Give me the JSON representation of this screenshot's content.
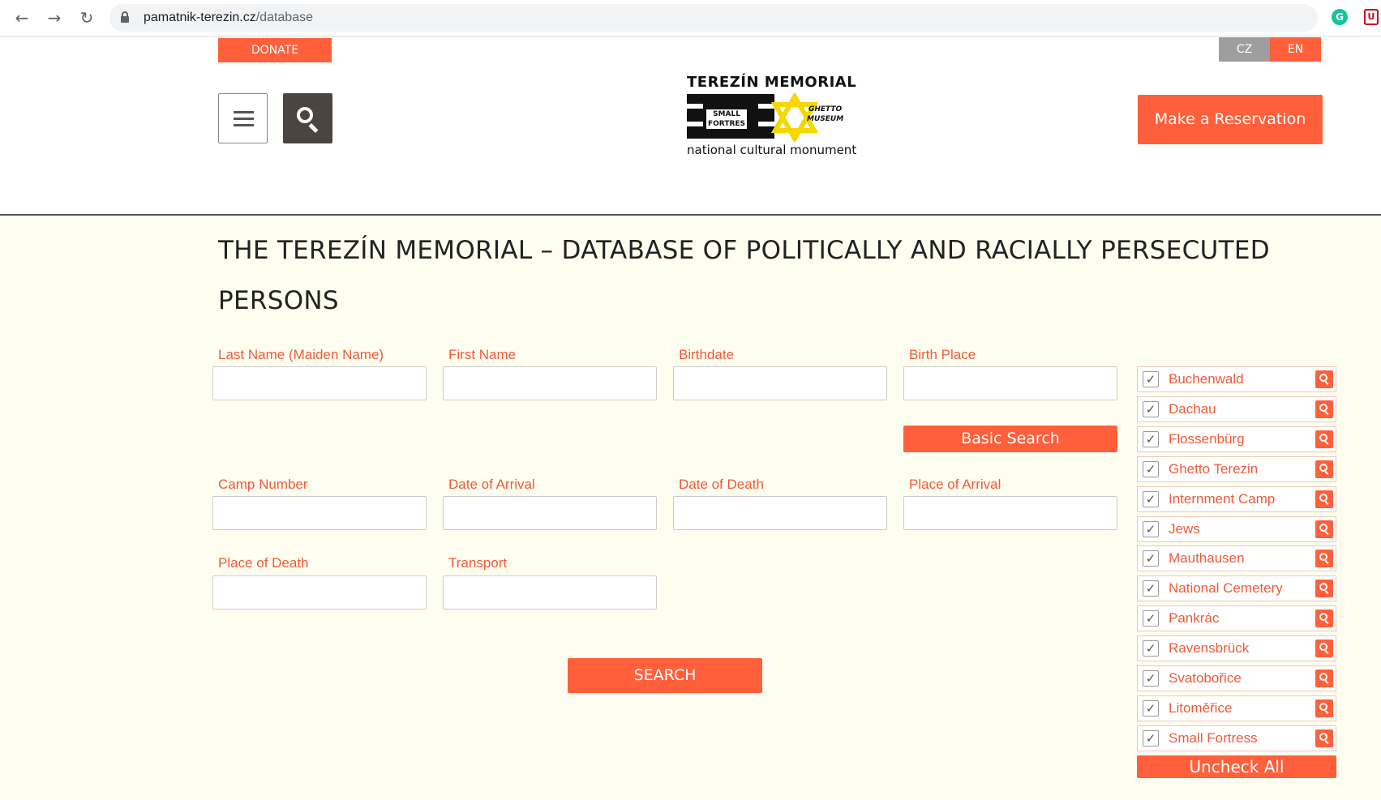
{
  "browser": {
    "url_host": "pamatnik-terezin.cz",
    "url_path": "/database",
    "ext_grammarly": "G",
    "ext_pocket": "U"
  },
  "header": {
    "donate_label": "DONATE",
    "lang_cz": "CZ",
    "lang_en": "EN",
    "reservation_label": "Make a Reservation",
    "logo": {
      "title": "TEREZÍN MEMORIAL",
      "small_fortress_line1": "SMALL",
      "small_fortress_line2": "FORTRES",
      "ghetto_museum_line1": "GHETTO",
      "ghetto_museum_line2": "MUSEUM",
      "subtitle": "national cultural monument"
    }
  },
  "page": {
    "title_line1": "THE TEREZÍN MEMORIAL – DATABASE OF POLITICALLY AND RACIALLY PERSECUTED",
    "title_line2": "PERSONS"
  },
  "form": {
    "last_name": {
      "label": "Last Name (Maiden Name)",
      "value": ""
    },
    "first_name": {
      "label": "First Name",
      "value": ""
    },
    "birthdate": {
      "label": "Birthdate",
      "value": ""
    },
    "birth_place": {
      "label": "Birth Place",
      "value": ""
    },
    "camp_number": {
      "label": "Camp Number",
      "value": ""
    },
    "date_of_arrival": {
      "label": "Date of Arrival",
      "value": ""
    },
    "date_of_death": {
      "label": "Date of Death",
      "value": ""
    },
    "place_of_arrival": {
      "label": "Place of Arrival",
      "value": ""
    },
    "place_of_death": {
      "label": "Place of Death",
      "value": ""
    },
    "transport": {
      "label": "Transport",
      "value": ""
    },
    "basic_search_label": "Basic Search",
    "search_label": "SEARCH"
  },
  "filters": {
    "check_glyph": "✓",
    "items": [
      {
        "label": "Buchenwald",
        "checked": true
      },
      {
        "label": "Dachau",
        "checked": true
      },
      {
        "label": "Flossenbürg",
        "checked": true
      },
      {
        "label": "Ghetto Terezin",
        "checked": true
      },
      {
        "label": "Internment Camp",
        "checked": true
      },
      {
        "label": "Jews",
        "checked": true
      },
      {
        "label": "Mauthausen",
        "checked": true
      },
      {
        "label": "National Cemetery",
        "checked": true
      },
      {
        "label": "Pankrác",
        "checked": true
      },
      {
        "label": "Ravensbrück",
        "checked": true
      },
      {
        "label": "Svatobořice",
        "checked": true
      },
      {
        "label": "Litoměřice",
        "checked": true
      },
      {
        "label": "Small Fortress",
        "checked": true
      }
    ],
    "uncheck_all_label": "Uncheck All"
  },
  "colors": {
    "accent": "#ff5f3a",
    "label_text": "#ef5a3a",
    "page_background": "#fefef0"
  }
}
